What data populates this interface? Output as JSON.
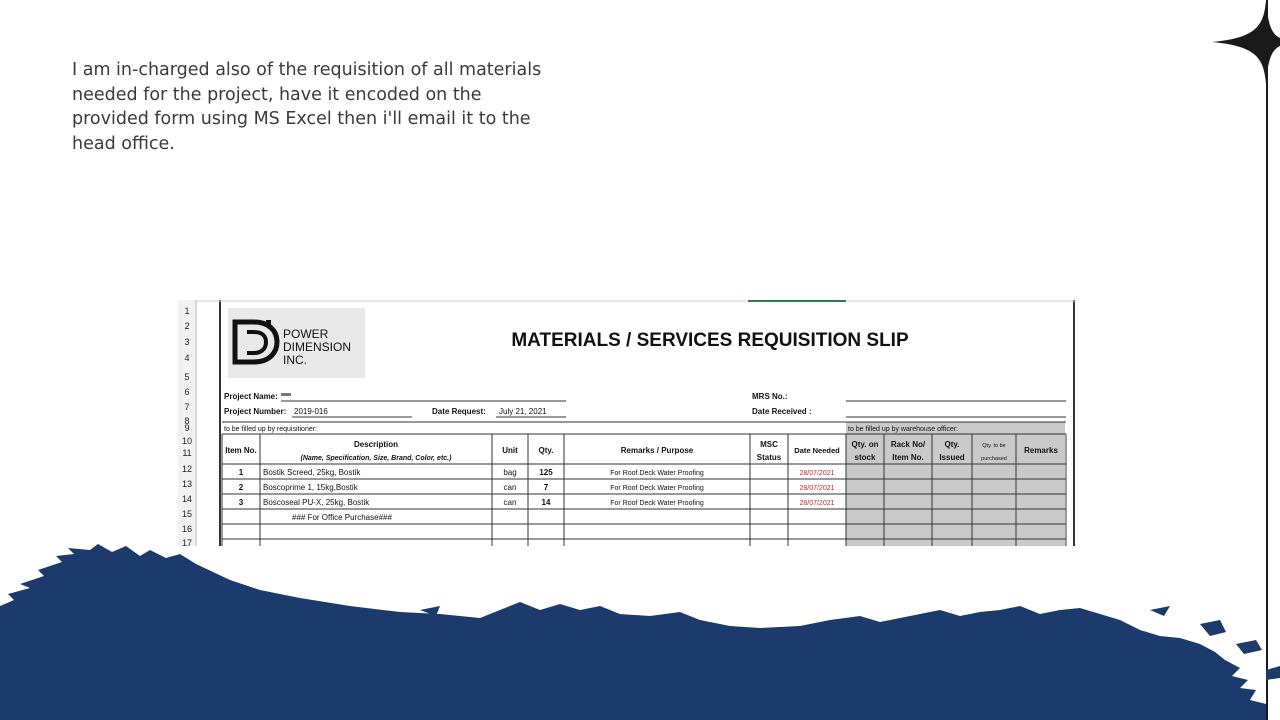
{
  "slide": {
    "text": "I am in-charged also of the requisition of all materials needed for the project, have it encoded on the provided form using MS Excel then i'll email it to the head office."
  },
  "colors": {
    "navy": "#1c3a6b",
    "date_red": "#c0282d",
    "gray_fill": "#c9c9c9"
  },
  "sheet": {
    "row_numbers": [
      "1",
      "2",
      "3",
      "4",
      "5",
      "6",
      "7",
      "8",
      "9",
      "10",
      "11",
      "12",
      "13",
      "14",
      "15",
      "16",
      "17"
    ],
    "logo": {
      "line1": "POWER",
      "line2": "DIMENSION",
      "line3": "INC."
    },
    "title": "MATERIALS / SERVICES REQUISITION SLIP",
    "project_name_label": "Project Name:",
    "project_number_label": "Project Number:",
    "project_number": "2019-016",
    "date_request_label": "Date Request:",
    "date_request": "July 21, 2021",
    "mrs_label": "MRS No.:",
    "date_received_label": "Date Received :",
    "requisitioner_note": "to be filled up by requisitioner:",
    "warehouse_note": "to be filled up by warehouse officer:",
    "headers": {
      "item_no": "Item No.",
      "description": "Description",
      "description_sub": "(Name, Specification, Size, Brand, Color, etc.)",
      "unit": "Unit",
      "qty": "Qty.",
      "remarks_purpose": "Remarks / Purpose",
      "msc_1": "MSC",
      "msc_2": "Status",
      "date_needed": "Date Needed",
      "qty_stock_1": "Qty. on",
      "qty_stock_2": "stock",
      "rack_1": "Rack No/",
      "rack_2": "Item No.",
      "issued_1": "Qty.",
      "issued_2": "Issued",
      "purch_1": "Qty. to be",
      "purch_2": "purchased",
      "remarks": "Remarks"
    },
    "rows": [
      {
        "no": "1",
        "desc": "Bostik Screed, 25kg, Bostik",
        "unit": "bag",
        "qty": "125",
        "purpose": "For Roof Deck Water Proofing",
        "date": "28/07/2021"
      },
      {
        "no": "2",
        "desc": "Boscoprime 1, 15kg,Bostik",
        "unit": "can",
        "qty": "7",
        "purpose": "For Roof Deck Water Proofing",
        "date": "28/07/2021"
      },
      {
        "no": "3",
        "desc": "Boscoseal PU-X, 25kg, Bostik",
        "unit": "can",
        "qty": "14",
        "purpose": "For Roof Deck Water Proofing",
        "date": "28/07/2021"
      }
    ],
    "office_note": "### For Office Purchase###"
  }
}
